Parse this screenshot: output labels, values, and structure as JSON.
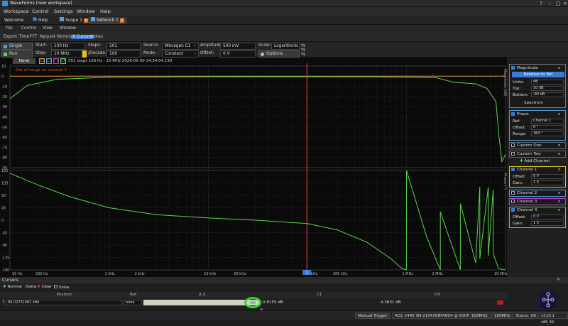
{
  "window": {
    "title": "WaveForms (new workspace)"
  },
  "menu": [
    "Workspace",
    "Control",
    "Settings",
    "Window",
    "Help"
  ],
  "tabs": [
    {
      "label": "Welcome"
    },
    {
      "label": "Help"
    },
    {
      "label": "Scope 1"
    },
    {
      "label": "Network 1"
    }
  ],
  "subtoolbar": {
    "file": "File",
    "control": "Control",
    "view": "View",
    "window": "Window"
  },
  "toolmenu": [
    "Export",
    "Time",
    "FFT",
    "Nyquist",
    "Nichols",
    "X Cursors",
    "Notes"
  ],
  "params": {
    "single": "Single",
    "run": "Run",
    "start_label": "Start:",
    "start": "100 Hz",
    "stop_label": "Stop:",
    "stop": "10 MHz",
    "steps_label": "Steps:",
    "steps": "501",
    "decade_label": "/Decade:",
    "decade": "100",
    "source_label": "Source:",
    "source": "Wavegen C1",
    "mode_label": "Mode:",
    "mode": "Constant",
    "amplitude_label": "Amplitude:",
    "amplitude": "500 mV",
    "offset_label": "Offset:",
    "offset": "0 V",
    "scale_label": "Scale:",
    "scale": "Logarithmic",
    "options": "Options"
  },
  "status": {
    "done": "Done",
    "channels": [
      "C1",
      "C2",
      "C3",
      "C4"
    ],
    "info": "501 steps  100 Hz - 10 MHz  2026-05-30 14:34:04.190",
    "warning": "Out of range on channel 2"
  },
  "right": {
    "magnitude": "Magnitude",
    "relative": "Relative to Ref",
    "units_label": "Units:",
    "units": "dB",
    "top_label": "Top:",
    "top": "10 dB",
    "bottom_label": "Bottom:",
    "bottom": "-80 dB",
    "spectrum": "Spectrum",
    "phase": "Phase",
    "ref_label": "Ref:",
    "ref": "Channel 1",
    "offset_label": "Offset:",
    "offset": "0 °",
    "range_label": "Range:",
    "range": "360 °",
    "custom1": "Custom One",
    "custom2": "Custom Two",
    "add": "Add Channel",
    "ch1": "Channel 1",
    "ch1_offset": "0 V",
    "ch1_gain": "1 X",
    "ch2": "Channel 2",
    "ch3": "Channel 3",
    "ch4": "Channel 4",
    "ch4_offset": "0 V",
    "ch4_gain": "1 X",
    "gain_label": "Gain:"
  },
  "cursors": {
    "title": "Cursors",
    "normal": "Normal",
    "delta": "Delta",
    "clear": "Clear",
    "show": "Show",
    "col_position": "Position",
    "col_ref": "Ref",
    "col_dx": "Δ X",
    "col_c1": "C1",
    "col_c4": "C4",
    "row_position": "99.02731481 kHz",
    "row_ref": "none",
    "row_c1": "-0.8155 dB",
    "row_c4": "-4.3831 dB"
  },
  "statusbar": {
    "trigger": "Manual Trigger",
    "device": "AD2 2440  SN:210436BFA804 @ 600MHz",
    "rate1": "100MHz",
    "rate2": "100MHz",
    "status": "Status: OK",
    "version": "v3.25.1 x86_64"
  },
  "colors": {
    "trace": "#58d64a",
    "cursor": "#e04040",
    "accent": "#3a7bd5"
  },
  "chart_data": [
    {
      "type": "line",
      "title": "",
      "xlabel": "",
      "ylabel": "Magnitude (dB)",
      "xscale": "log",
      "xlim": [
        100,
        10000000
      ],
      "ylim": [
        -90,
        10
      ],
      "yticks": [
        10,
        0,
        -10,
        -20,
        -30,
        -40,
        -50,
        -60,
        -70,
        -80,
        -90
      ],
      "series": [
        {
          "name": "C1",
          "color": "#d89a3a",
          "x": [
            100,
            10000000
          ],
          "y": [
            0,
            0
          ]
        },
        {
          "name": "C4",
          "color": "#58d64a",
          "x": [
            100,
            150,
            300,
            1000,
            10000,
            100000,
            500000,
            1000000,
            2000000,
            3000000,
            5000000,
            6500000,
            8000000,
            8600000,
            9200000,
            10000000
          ],
          "y": [
            -22,
            -9,
            -3,
            -1,
            -0.5,
            -0.5,
            -0.7,
            -1,
            -1.5,
            -6,
            -7.5,
            -12,
            -25,
            -60,
            -84,
            -77
          ]
        }
      ],
      "grid": true
    },
    {
      "type": "line",
      "title": "",
      "xlabel": "",
      "ylabel": "Phase (°)",
      "xscale": "log",
      "xlim": [
        100,
        10000000
      ],
      "ylim": [
        -180,
        180
      ],
      "yticks": [
        180,
        135,
        90,
        45,
        0,
        -45,
        -90,
        -135,
        -180
      ],
      "xticks": [
        "10 Hz",
        "200 Hz",
        "1 kHz",
        "2 kHz",
        "10 kHz",
        "20 kHz",
        "100 kHz",
        "200 kHz",
        "1 MHz",
        "2 MHz",
        "10 MHz"
      ],
      "series": [
        {
          "name": "C4",
          "color": "#58d64a",
          "x": [
            100,
            200,
            400,
            1000,
            3000,
            10000,
            30000,
            100000,
            200000,
            400000,
            700000,
            900000,
            1000000,
            1001000,
            1600000,
            2200000,
            2201000,
            3500000,
            3501000,
            5000000,
            5500000,
            5501000,
            6700000,
            6701000,
            7500000,
            7501000,
            8500000,
            10000000
          ],
          "y": [
            170,
            125,
            85,
            45,
            20,
            8,
            0,
            -12,
            -35,
            -80,
            -140,
            -175,
            -180,
            180,
            -60,
            -180,
            30,
            -180,
            60,
            -155,
            120,
            -140,
            120,
            -130,
            110,
            -120,
            -175,
            -180
          ]
        }
      ],
      "cursor_x": 99027,
      "cursor_label": "1",
      "grid": true
    }
  ]
}
